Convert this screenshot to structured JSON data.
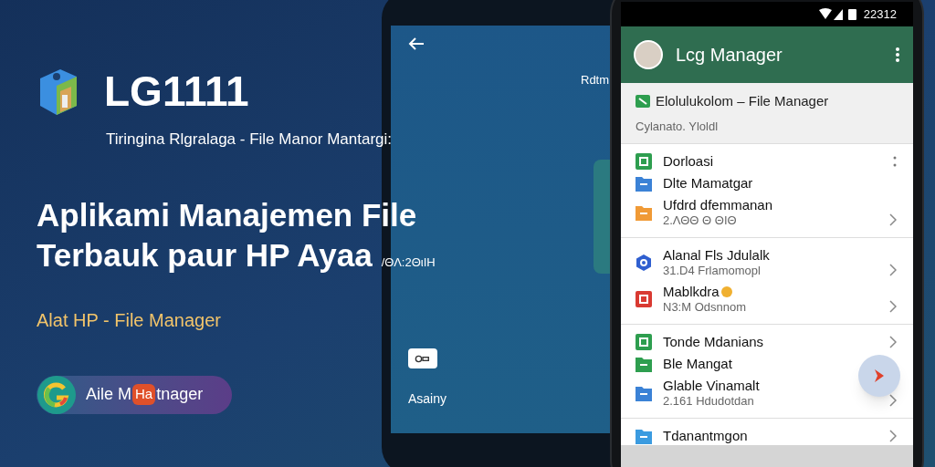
{
  "promo": {
    "brand": "LG1111",
    "tagline": "Tiringina Rlgralaga - File Manor Mantargi:",
    "headline": [
      "Aplikami Manajemen File",
      "Terbauk paur HP Ayaa"
    ],
    "headline_note": "/ΘΛ:2ΘιΙΗ",
    "subtitle": "Alat HP - File Manager",
    "pill": {
      "text_before": "Aile M",
      "badge": "Ha",
      "text_after": "tnager"
    }
  },
  "back_phone": {
    "top_label": "Rdtm",
    "badge_label": "Asainy"
  },
  "phone": {
    "status_time": "22312",
    "app_title": "Lcg Manager",
    "banner": {
      "title": "Elolulukolom – File Manager",
      "subtitle": "Cylanato. Yloldl"
    },
    "sections": [
      {
        "items": [
          {
            "title": "Dorloasi",
            "color": "#2e9e4f",
            "kind": "square",
            "menu": true,
            "chevron": false
          },
          {
            "title": "Dlte Mamatgar",
            "color": "#3b82d6",
            "kind": "folder",
            "menu": false,
            "chevron": false
          },
          {
            "title": "Ufdrd dfemmanan",
            "subtitle": "2.ΛΘΘ Θ ΘΙΘ",
            "color": "#f09a36",
            "kind": "folder",
            "menu": false,
            "chevron": true
          }
        ]
      },
      {
        "items": [
          {
            "title": "Alanal Fls Jdulalk",
            "subtitle": "31.D4 Frlamomopl",
            "color": "#2f5fd0",
            "kind": "hexagon",
            "menu": false,
            "chevron": true
          },
          {
            "title": "Mablkdra",
            "subtitle": "N3:M Odsnnom",
            "color": "#d93a32",
            "kind": "square",
            "menu": false,
            "chevron": true,
            "emoji": true
          }
        ]
      },
      {
        "items": [
          {
            "title": "Tonde Mdanians",
            "color": "#2e9e4f",
            "kind": "square",
            "menu": false,
            "chevron": true
          },
          {
            "title": "Ble Mangat",
            "color": "#2e9e4f",
            "kind": "folder",
            "menu": false,
            "chevron": false
          },
          {
            "title": "Glable Vinamalt",
            "subtitle": "2.161 Hdudotdan",
            "color": "#3b82d6",
            "kind": "folder",
            "menu": false,
            "chevron": true
          }
        ]
      },
      {
        "items": [
          {
            "title": "Tdanantmgon",
            "color": "#3b9be0",
            "kind": "folder",
            "menu": false,
            "chevron": true
          }
        ]
      }
    ]
  }
}
